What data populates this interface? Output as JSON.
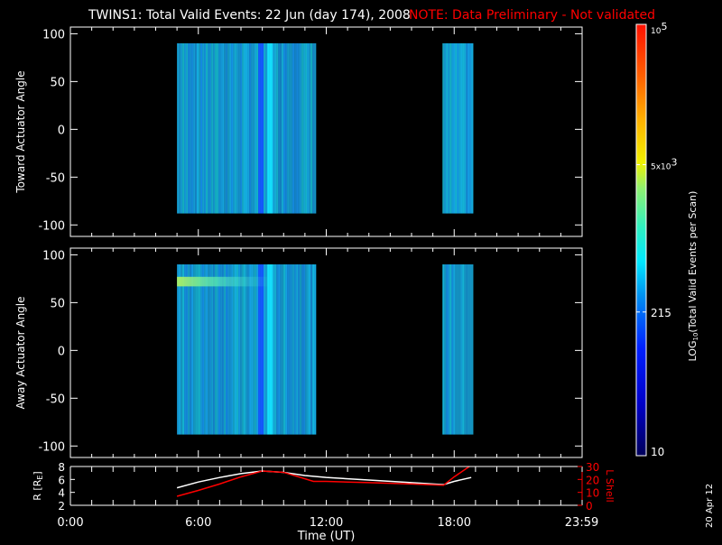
{
  "chart_data": {
    "type": "heatmap",
    "title": "TWINS1: Total Valid Events: 22 Jun (day 174), 2008",
    "note": "NOTE: Data Preliminary - Not validated",
    "xlabel": "Time (UT)",
    "x_ticks": [
      "0:00",
      "6:00",
      "12:00",
      "18:00",
      "23:59"
    ],
    "x_tick_hours": [
      0,
      6,
      12,
      18,
      23.98
    ],
    "xlim_hours": [
      0,
      24
    ],
    "panels": [
      {
        "ylabel": "Toward Actuator Angle",
        "y_ticks": [
          "100",
          "50",
          "0",
          "-50",
          "-100"
        ],
        "y_tick_values": [
          100,
          50,
          0,
          -50,
          -100
        ],
        "ylim": [
          -112,
          107
        ],
        "data_intervals_hours": [
          [
            5.0,
            11.45
          ],
          [
            17.45,
            18.82
          ]
        ],
        "angle_range": [
          -88,
          90
        ],
        "typical_log_value": 2.4,
        "bright_band": null
      },
      {
        "ylabel": "Away Actuator Angle",
        "y_ticks": [
          "100",
          "50",
          "0",
          "-50",
          "-100"
        ],
        "y_tick_values": [
          100,
          50,
          0,
          -50,
          -100
        ],
        "ylim": [
          -112,
          107
        ],
        "data_intervals_hours": [
          [
            5.0,
            11.45
          ],
          [
            17.45,
            18.82
          ]
        ],
        "angle_range": [
          -88,
          90
        ],
        "typical_log_value": 2.4,
        "bright_band": {
          "angle": 72,
          "hours": [
            5.0,
            9.5
          ]
        }
      }
    ],
    "colorbar": {
      "label": "LOG10(Total Valid Events per Scan)",
      "label_main": "LOG",
      "label_sub": "10",
      "label_rest": "(Total Valid Events per Scan)",
      "min": 10,
      "max": 100000,
      "ticks": [
        {
          "text": "10",
          "value": 10
        },
        {
          "text": "215",
          "value": 215
        },
        {
          "text": "5x10",
          "sup": "3",
          "value": 5000
        },
        {
          "text": "10",
          "sup": "5",
          "value": 100000
        }
      ]
    },
    "orbit": {
      "left_label": "R [R",
      "left_label_sub": "E",
      "left_label_end": "]",
      "right_label": "L Shell",
      "left_ticks": [
        "2",
        "4",
        "6",
        "8"
      ],
      "left_tick_values": [
        2,
        4,
        6,
        8
      ],
      "left_ylim": [
        2,
        8
      ],
      "right_ticks": [
        "0",
        "10",
        "20",
        "30"
      ],
      "right_tick_values": [
        0,
        10,
        20,
        30
      ],
      "right_ylim": [
        0,
        30
      ],
      "series": [
        {
          "name": "R",
          "color": "#ffffff",
          "hours": [
            5.0,
            6.0,
            7.0,
            8.0,
            9.0,
            10.0,
            11.0,
            12.0,
            14.0,
            16.0,
            17.5,
            18.0,
            18.8
          ],
          "values": [
            4.7,
            5.6,
            6.3,
            6.9,
            7.3,
            7.1,
            6.6,
            6.3,
            5.9,
            5.5,
            5.2,
            5.7,
            6.3
          ]
        },
        {
          "name": "L Shell",
          "color": "#ff0000",
          "hours": [
            5.0,
            6.0,
            7.0,
            8.0,
            9.0,
            10.0,
            11.4,
            12.0,
            14.0,
            16.0,
            17.5,
            18.0,
            18.8
          ],
          "values": [
            7,
            11.5,
            16.5,
            22,
            26.5,
            25.5,
            18.5,
            18.5,
            17.5,
            16.5,
            15.5,
            22,
            31
          ]
        }
      ]
    },
    "date_stamp": "20 Apr 12",
    "colors": {
      "note": "#ff0000",
      "axis": "#ffffff",
      "background": "#000000"
    }
  }
}
